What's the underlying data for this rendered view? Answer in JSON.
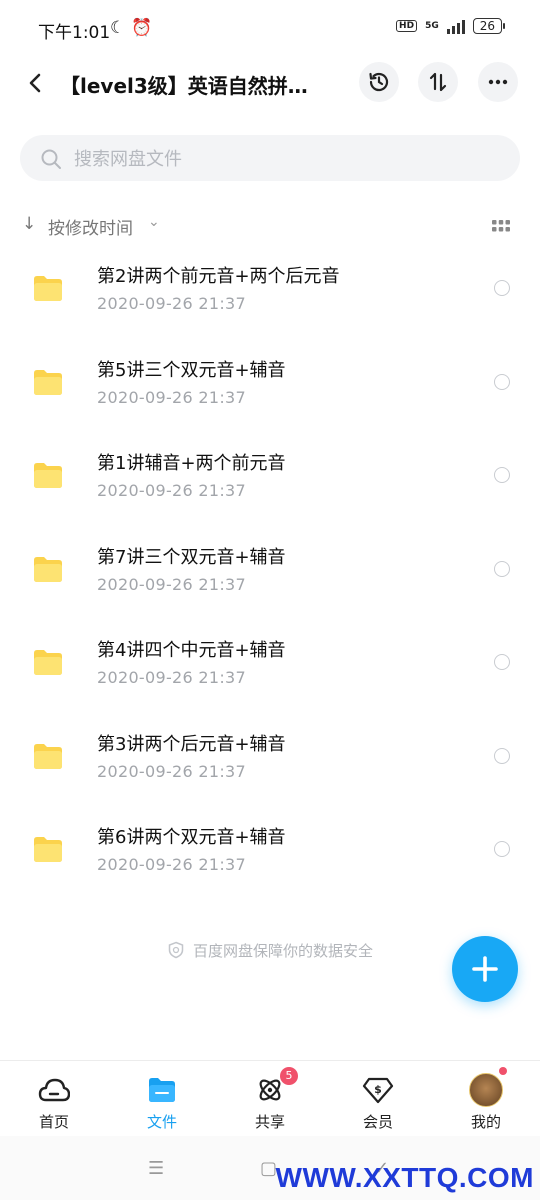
{
  "status_bar": {
    "time": "下午1:01",
    "hd": "HD",
    "net": "5G",
    "battery": "26"
  },
  "header": {
    "title": "【level3级】英语自然拼…"
  },
  "search": {
    "placeholder": "搜索网盘文件",
    "value": ""
  },
  "sort": {
    "label": "按修改时间"
  },
  "files": [
    {
      "name": "第2讲两个前元音+两个后元音",
      "date": "2020-09-26  21:37"
    },
    {
      "name": "第5讲三个双元音+辅音",
      "date": "2020-09-26  21:37"
    },
    {
      "name": "第1讲辅音+两个前元音",
      "date": "2020-09-26  21:37"
    },
    {
      "name": "第7讲三个双元音+辅音",
      "date": "2020-09-26  21:37"
    },
    {
      "name": "第4讲四个中元音+辅音",
      "date": "2020-09-26  21:37"
    },
    {
      "name": "第3讲两个后元音+辅音",
      "date": "2020-09-26  21:37"
    },
    {
      "name": "第6讲两个双元音+辅音",
      "date": "2020-09-26  21:37"
    }
  ],
  "footer_note": "百度网盘保障你的数据安全",
  "tabs": [
    {
      "label": "首页",
      "icon": "home-cloud-icon"
    },
    {
      "label": "文件",
      "icon": "folder-icon",
      "active": true
    },
    {
      "label": "共享",
      "icon": "share-atom-icon",
      "badge": "5"
    },
    {
      "label": "会员",
      "icon": "vip-diamond-icon"
    },
    {
      "label": "我的",
      "icon": "avatar-icon"
    }
  ],
  "watermark": "WWW.XXTTQ.COM",
  "colors": {
    "accent": "#18a0f0",
    "folder": "#fbd34d",
    "badge": "#f0516b"
  }
}
